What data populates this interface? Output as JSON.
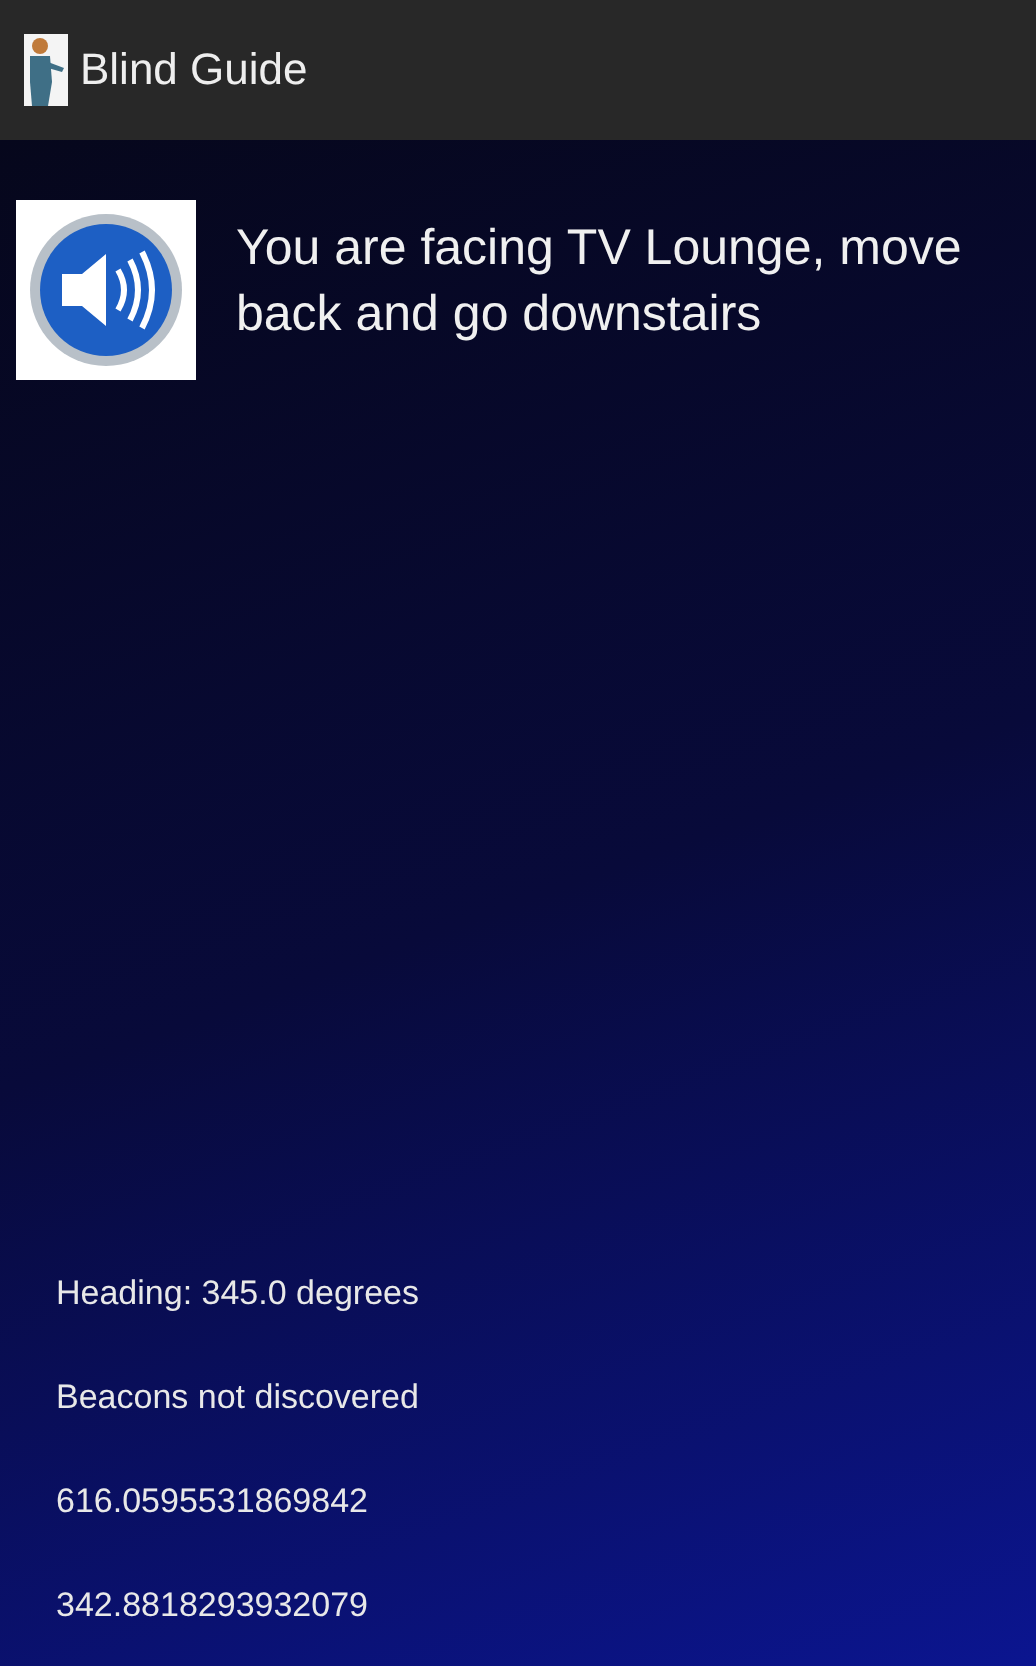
{
  "app_bar": {
    "title": "Blind Guide"
  },
  "message": "You are facing TV Lounge, move back and go downstairs",
  "readings": [
    "Heading: 345.0 degrees",
    "Beacons not discovered",
    "616.0595531869842",
    "342.8818293932079"
  ]
}
